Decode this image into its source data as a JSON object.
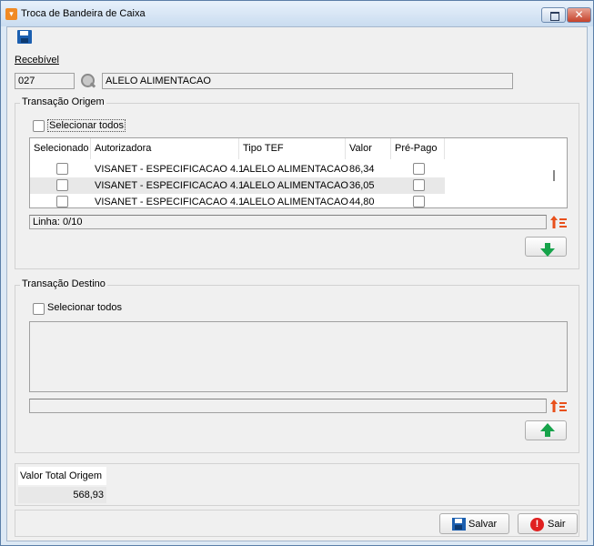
{
  "window": {
    "title": "Troca de Bandeira de Caixa"
  },
  "toolbar": {
    "save_icon": "save-icon"
  },
  "recebivel": {
    "label": "Recebível",
    "code": "027",
    "search_icon": "magnifier-icon",
    "description": "ALELO ALIMENTACAO"
  },
  "origem": {
    "legend": "Transação Origem",
    "select_all": "Selecionar todos",
    "columns": [
      "Selecionado",
      "Autorizadora",
      "Tipo TEF",
      "Valor",
      "Pré-Pago"
    ],
    "rows": [
      {
        "autorizadora": "VISANET - ESPECIFICACAO 4.1",
        "tipo_tef": "ALELO ALIMENTACAO",
        "valor": "86,34"
      },
      {
        "autorizadora": "VISANET - ESPECIFICACAO 4.1",
        "tipo_tef": "ALELO ALIMENTACAO",
        "valor": "36,05"
      },
      {
        "autorizadora": "VISANET - ESPECIFICACAO 4.1",
        "tipo_tef": "ALELO ALIMENTACAO",
        "valor": "44,80"
      }
    ],
    "status": "Linha: 0/10",
    "move_button_icon": "arrow-down-icon"
  },
  "destino": {
    "legend": "Transação Destino",
    "select_all": "Selecionar todos",
    "status": "",
    "move_button_icon": "arrow-up-icon"
  },
  "total": {
    "label": "Valor Total Origem",
    "value": "568,93"
  },
  "actions": {
    "save_label": "Salvar",
    "exit_label": "Sair"
  },
  "colors": {
    "accent_green": "#16a34a",
    "sort_icon_orange": "#e8501c",
    "exit_red": "#e02020"
  }
}
